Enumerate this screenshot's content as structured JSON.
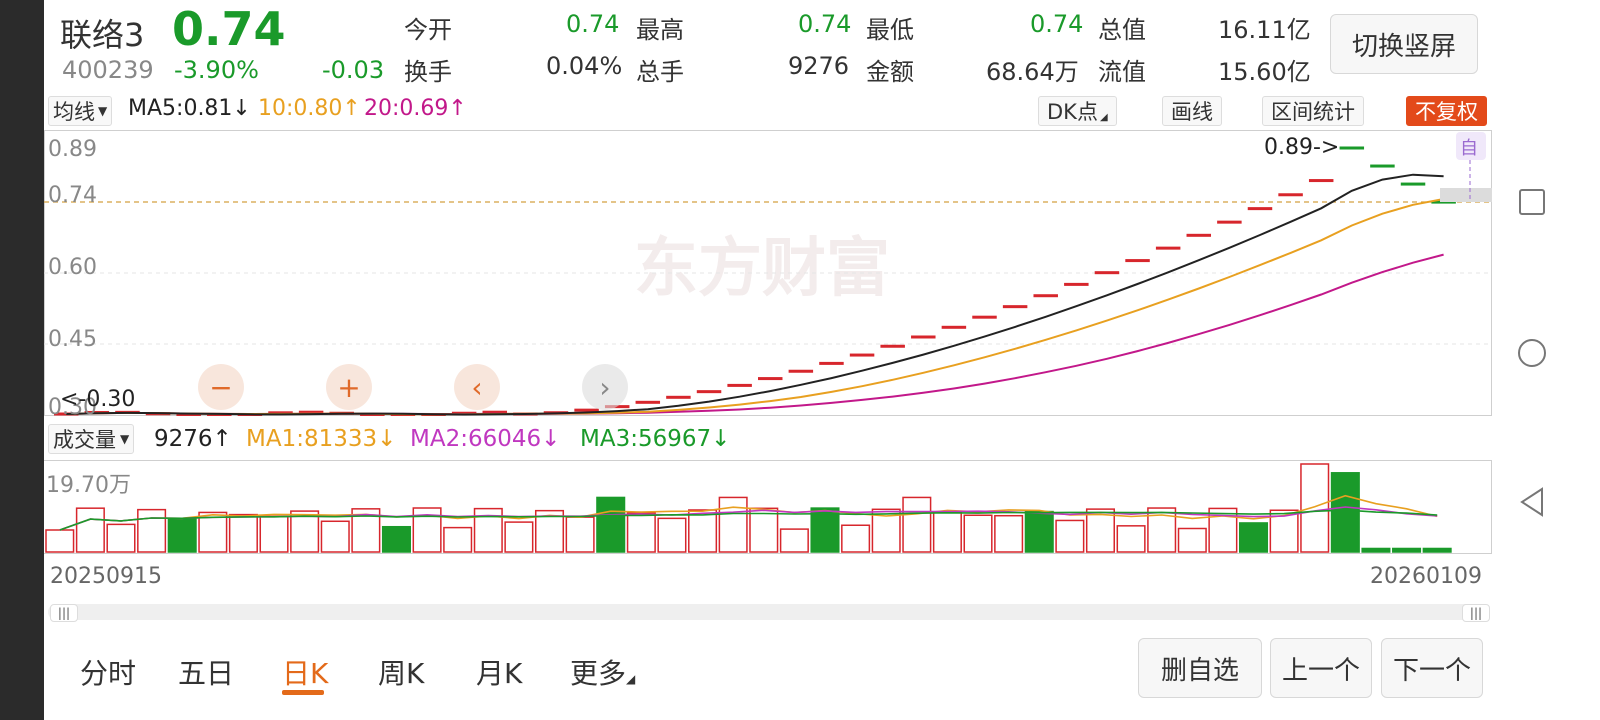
{
  "header": {
    "name": "联络3",
    "code": "400239",
    "price": "0.74",
    "change_pct": "-3.90%",
    "change": "-0.03",
    "stats": [
      {
        "label": "今开",
        "value": "0.74",
        "color": "#1a9a2a"
      },
      {
        "label": "最高",
        "value": "0.74",
        "color": "#1a9a2a"
      },
      {
        "label": "最低",
        "value": "0.74",
        "color": "#1a9a2a"
      },
      {
        "label": "总值",
        "value": "16.11亿",
        "color": "#333333"
      },
      {
        "label": "换手",
        "value": "0.04%",
        "color": "#333333"
      },
      {
        "label": "总手",
        "value": "9276",
        "color": "#333333"
      },
      {
        "label": "金额",
        "value": "68.64万",
        "color": "#333333"
      },
      {
        "label": "流值",
        "value": "15.60亿",
        "color": "#333333"
      }
    ],
    "switch_button": "切换竖屏"
  },
  "toolbar": {
    "ma_selector": "均线",
    "ma5": "MA5:0.81↓",
    "ma10": "10:0.80↑",
    "ma20": "20:0.69↑",
    "dk_button": "DK点",
    "draw_button": "画线",
    "range_button": "区间统计",
    "adjust_button": "不复权"
  },
  "chart": {
    "y_labels": [
      "0.89",
      "0.74",
      "0.60",
      "0.45",
      "0.30"
    ],
    "max_label": "0.89->",
    "min_label": "<-0.30",
    "auto_badge": "自",
    "watermark": "东方财富"
  },
  "volume": {
    "selector": "成交量",
    "current": "9276↑",
    "ma1": "MA1:81333↓",
    "ma2": "MA2:66046↓",
    "ma3": "MA3:56967↓",
    "y_label": "19.70万",
    "start_date": "20250915",
    "end_date": "20260109"
  },
  "colors": {
    "up": "#d7262c",
    "down": "#1a9a2a",
    "ma5": "#222222",
    "ma10": "#e8a020",
    "ma20": "#c2188a",
    "vol_ma3": "#1a9a2a",
    "accent": "#e36a1a"
  },
  "tabs": [
    "分时",
    "五日",
    "日K",
    "周K",
    "月K",
    "更多"
  ],
  "active_tab": "日K",
  "bottom_buttons": [
    "删自选",
    "上一个",
    "下一个"
  ]
}
